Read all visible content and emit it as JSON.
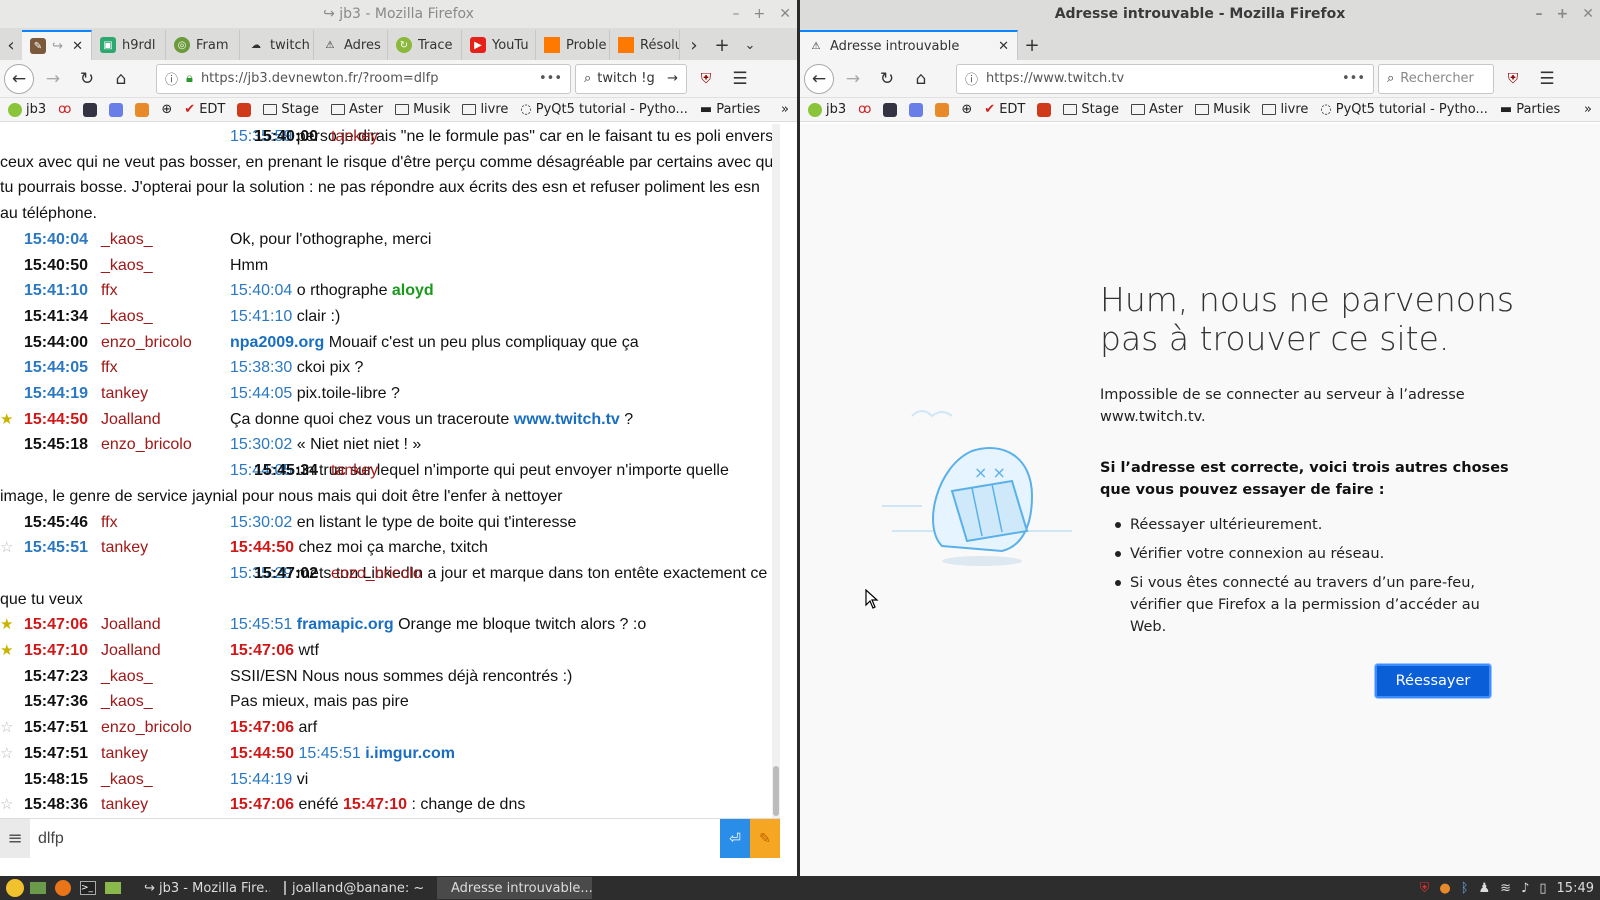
{
  "left_window": {
    "title": "↪ jb3 - Mozilla Firefox",
    "tabs": [
      "",
      "h9rdl",
      "Fram",
      "twitch",
      "Adres",
      "Trace",
      "YouTu",
      "Proble",
      "Résolu"
    ],
    "url": "https://jb3.devnewton.fr/?room=dlfp",
    "search_value": "twitch !g"
  },
  "right_window": {
    "title": "Adresse introuvable - Mozilla Firefox",
    "tab": "Adresse introuvable",
    "url": "https://www.twitch.tv",
    "search_placeholder": "Rechercher"
  },
  "bookmarks": [
    "jb3",
    "EDT",
    "Stage",
    "Aster",
    "Musik",
    "livre",
    "PyQt5 tutorial - Pytho...",
    "Parties"
  ],
  "chat": {
    "messages": [
      {
        "time": "15:40:00",
        "user": "tankey",
        "ref1": "15:35:59",
        "text": " perso je dirais \"ne le formule pas\" car en le faisant tu es poli envers ceux avec qui ne veut pas bosser, en prenant le risque d'être perçu comme désagréable par certains avec qui tu pourrais bosse. J'opterai pour la solution : ne pas répondre aux écrits des esn et refuser poliment les esn au téléphone."
      },
      {
        "time": "15:40:04",
        "user": "_kaos_",
        "text": "Ok, pour l'othographe, merci"
      },
      {
        "time": "15:40:50",
        "user": "_kaos_",
        "text": "Hmm"
      },
      {
        "time": "15:41:10",
        "user": "ffx",
        "ref1": "15:40:04",
        "text": " o rthographe ",
        "nick": "aloyd"
      },
      {
        "time": "15:41:34",
        "user": "_kaos_",
        "ref1": "15:41:10",
        "text": " clair :)"
      },
      {
        "time": "15:44:00",
        "user": "enzo_bricolo",
        "link": "npa2009.org",
        "text": " Mouaif c'est un peu plus compliquay que ça"
      },
      {
        "time": "15:44:05",
        "user": "ffx",
        "ref1": "15:38:30",
        "text": " ckoi pix ?"
      },
      {
        "time": "15:44:19",
        "user": "tankey",
        "ref1": "15:44:05",
        "text": " pix.toile-libre ?"
      },
      {
        "time": "15:44:50",
        "user": "Joalland",
        "text": "Ça donne quoi chez vous un traceroute ",
        "link2": "www.twitch.tv",
        "text2": " ?"
      },
      {
        "time": "15:45:18",
        "user": "enzo_bricolo",
        "ref1": "15:30:02",
        "text": " « Niet niet niet ! »"
      },
      {
        "time": "15:45:34",
        "user": "tankey",
        "ref1": "15:44:05",
        "text": " un truc sur lequel n'importe qui peut envoyer n'importe quelle image, le genre de service jaynial pour nous mais qui doit être l'enfer à nettoyer"
      },
      {
        "time": "15:45:46",
        "user": "ffx",
        "ref1": "15:30:02",
        "text": " en listant le type de boite qui t'interesse"
      },
      {
        "time": "15:45:51",
        "user": "tankey",
        "ref1": "15:44:50",
        "text": " chez moi ça marche, txitch"
      },
      {
        "time": "15:47:02",
        "user": "enzo_bricolo",
        "ref1": "15:35:29",
        "text": " mets ton LinkedIn a jour et marque dans ton entête exactement ce que tu veux"
      },
      {
        "time": "15:47:06",
        "user": "Joalland",
        "ref1": "15:45:51",
        "link": "framapic.org",
        "text": " Orange me bloque twitch alors ? :o"
      },
      {
        "time": "15:47:10",
        "user": "Joalland",
        "ref1": "15:47:06",
        "text": " wtf"
      },
      {
        "time": "15:47:23",
        "user": "_kaos_",
        "text": "SSII/ESN Nous nous sommes déjà rencontrés :)"
      },
      {
        "time": "15:47:36",
        "user": "_kaos_",
        "text": "Pas mieux, mais pas pire"
      },
      {
        "time": "15:47:51",
        "user": "enzo_bricolo",
        "ref1": "15:47:06",
        "text": " arf"
      },
      {
        "time": "15:47:51",
        "user": "tankey",
        "ref1": "15:44:50",
        "ref2": "15:45:51",
        "link": "i.imgur.com"
      },
      {
        "time": "15:48:15",
        "user": "_kaos_",
        "ref1": "15:44:19",
        "text": " vi"
      },
      {
        "time": "15:48:36",
        "user": "tankey",
        "ref1": "15:47:06",
        "text": " enéfé ",
        "ref3": "15:47:10",
        "text2": " : change de dns"
      }
    ],
    "input_value": "dlfp"
  },
  "error_page": {
    "title": "Hum, nous ne parvenons pas à trouver ce site.",
    "description": "Impossible de se connecter au serveur à l’adresse www.twitch.tv.",
    "subtitle": "Si l’adresse est correcte, voici trois autres choses que vous pouvez essayer de faire :",
    "items": [
      "Réessayer ultérieurement.",
      "Vérifier votre connexion au réseau.",
      "Si vous êtes connecté au travers d’un pare-feu, vérifier que Firefox a la permission d’accéder au Web."
    ],
    "retry_label": "Réessayer"
  },
  "taskbar": {
    "tasks": [
      "↪ jb3 - Mozilla Fire...",
      "joalland@banane: ~",
      "Adresse introuvable..."
    ],
    "clock": "15:49"
  },
  "colors": {
    "accent": "#0a84ff",
    "time_red": "#d01717",
    "time_blue": "#2a78c2",
    "user": "#a01818",
    "retry": "#0a5ed8"
  }
}
